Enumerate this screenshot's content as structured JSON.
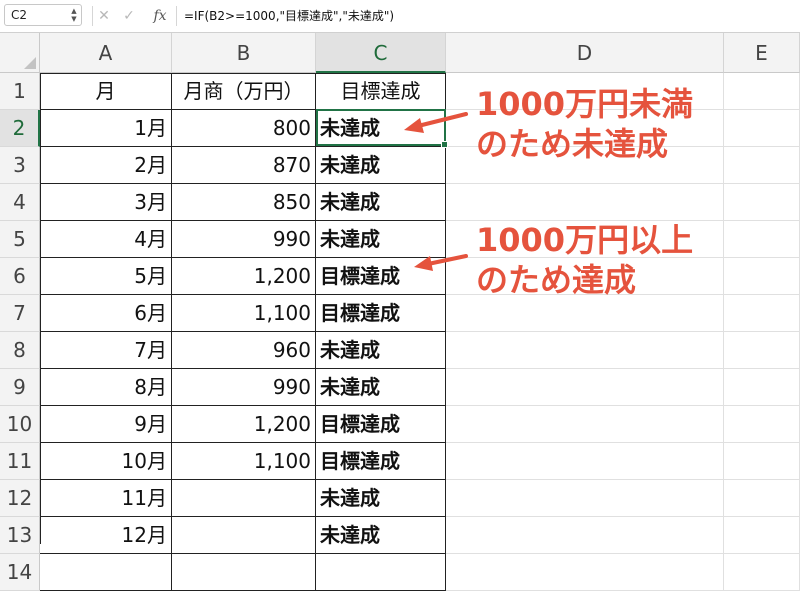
{
  "formula_bar": {
    "name_box": "C2",
    "cancel_icon": "cross-icon",
    "confirm_icon": "check-icon",
    "fx_label": "fx",
    "formula": "=IF(B2>=1000,\"目標達成\",\"未達成\")"
  },
  "columns": [
    "A",
    "B",
    "C",
    "D",
    "E"
  ],
  "rows": [
    "1",
    "2",
    "3",
    "4",
    "5",
    "6",
    "7",
    "8",
    "9",
    "10",
    "11",
    "12",
    "13",
    "14"
  ],
  "active_cell": "C2",
  "table": {
    "headers": [
      "月",
      "月商（万円）",
      "目標達成"
    ],
    "rows": [
      {
        "month": "1月",
        "sales": "800",
        "status": "未達成"
      },
      {
        "month": "2月",
        "sales": "870",
        "status": "未達成"
      },
      {
        "month": "3月",
        "sales": "850",
        "status": "未達成"
      },
      {
        "month": "4月",
        "sales": "990",
        "status": "未達成"
      },
      {
        "month": "5月",
        "sales": "1,200",
        "status": "目標達成"
      },
      {
        "month": "6月",
        "sales": "1,100",
        "status": "目標達成"
      },
      {
        "month": "7月",
        "sales": "960",
        "status": "未達成"
      },
      {
        "month": "8月",
        "sales": "990",
        "status": "未達成"
      },
      {
        "month": "9月",
        "sales": "1,200",
        "status": "目標達成"
      },
      {
        "month": "10月",
        "sales": "1,100",
        "status": "目標達成"
      },
      {
        "month": "11月",
        "sales": "",
        "status": "未達成"
      },
      {
        "month": "12月",
        "sales": "",
        "status": "未達成"
      }
    ]
  },
  "annotations": {
    "note1_line1": "1000万円未満",
    "note1_line2": "のため未達成",
    "note2_line1": "1000万円以上",
    "note2_line2": "のため達成",
    "color": "#e5533d"
  }
}
